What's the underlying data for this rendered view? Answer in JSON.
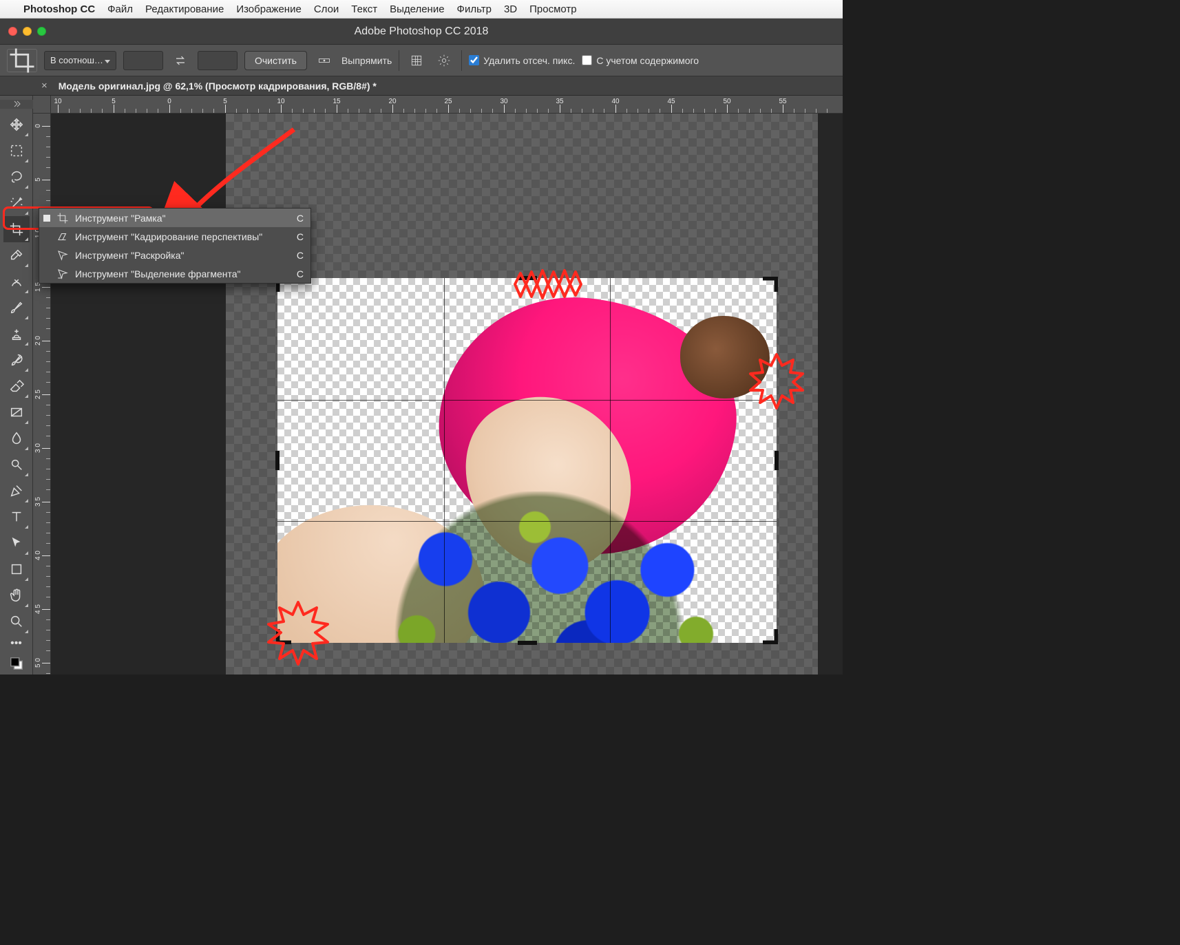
{
  "mac_menu": {
    "app_name": "Photoshop CC",
    "items": [
      "Файл",
      "Редактирование",
      "Изображение",
      "Слои",
      "Текст",
      "Выделение",
      "Фильтр",
      "3D",
      "Просмотр"
    ]
  },
  "titlebar": {
    "title": "Adobe Photoshop CC 2018"
  },
  "options_bar": {
    "ratio_dropdown": "В соотнош…",
    "clear_btn": "Очистить",
    "straighten_label": "Выпрямить",
    "delete_cropped_checkbox": {
      "checked": true,
      "label": "Удалить отсеч. пикс."
    },
    "content_aware_checkbox": {
      "checked": false,
      "label": "С учетом содержимого"
    }
  },
  "document_tab": {
    "title": "Модель оригинал.jpg @ 62,1% (Просмотр кадрирования, RGB/8#) *"
  },
  "ruler_h_labels": [
    "10",
    "5",
    "0",
    "5",
    "10",
    "15",
    "20",
    "25",
    "30",
    "35",
    "40",
    "45",
    "50",
    "55"
  ],
  "ruler_v_labels": [
    "0",
    "5",
    "1 0",
    "1 5",
    "2 0",
    "2 5",
    "3 0",
    "3 5",
    "4 0",
    "4 5",
    "5 0"
  ],
  "tools": [
    {
      "name": "move-tool"
    },
    {
      "name": "marquee-tool"
    },
    {
      "name": "lasso-tool"
    },
    {
      "name": "magic-wand-tool"
    },
    {
      "name": "crop-tool",
      "active": true
    },
    {
      "name": "eyedropper-tool"
    },
    {
      "name": "healing-brush-tool"
    },
    {
      "name": "brush-tool"
    },
    {
      "name": "clone-stamp-tool"
    },
    {
      "name": "history-brush-tool"
    },
    {
      "name": "eraser-tool"
    },
    {
      "name": "gradient-tool"
    },
    {
      "name": "blur-tool"
    },
    {
      "name": "dodge-tool"
    },
    {
      "name": "pen-tool"
    },
    {
      "name": "type-tool"
    },
    {
      "name": "path-select-tool"
    },
    {
      "name": "rectangle-tool"
    },
    {
      "name": "hand-tool"
    },
    {
      "name": "zoom-tool"
    }
  ],
  "flyout": {
    "items": [
      {
        "label": "Инструмент \"Рамка\"",
        "shortcut": "C",
        "selected": true
      },
      {
        "label": "Инструмент \"Кадрирование перспективы\"",
        "shortcut": "C",
        "selected": false
      },
      {
        "label": "Инструмент \"Раскройка\"",
        "shortcut": "C",
        "selected": false
      },
      {
        "label": "Инструмент \"Выделение фрагмента\"",
        "shortcut": "C",
        "selected": false
      }
    ]
  }
}
